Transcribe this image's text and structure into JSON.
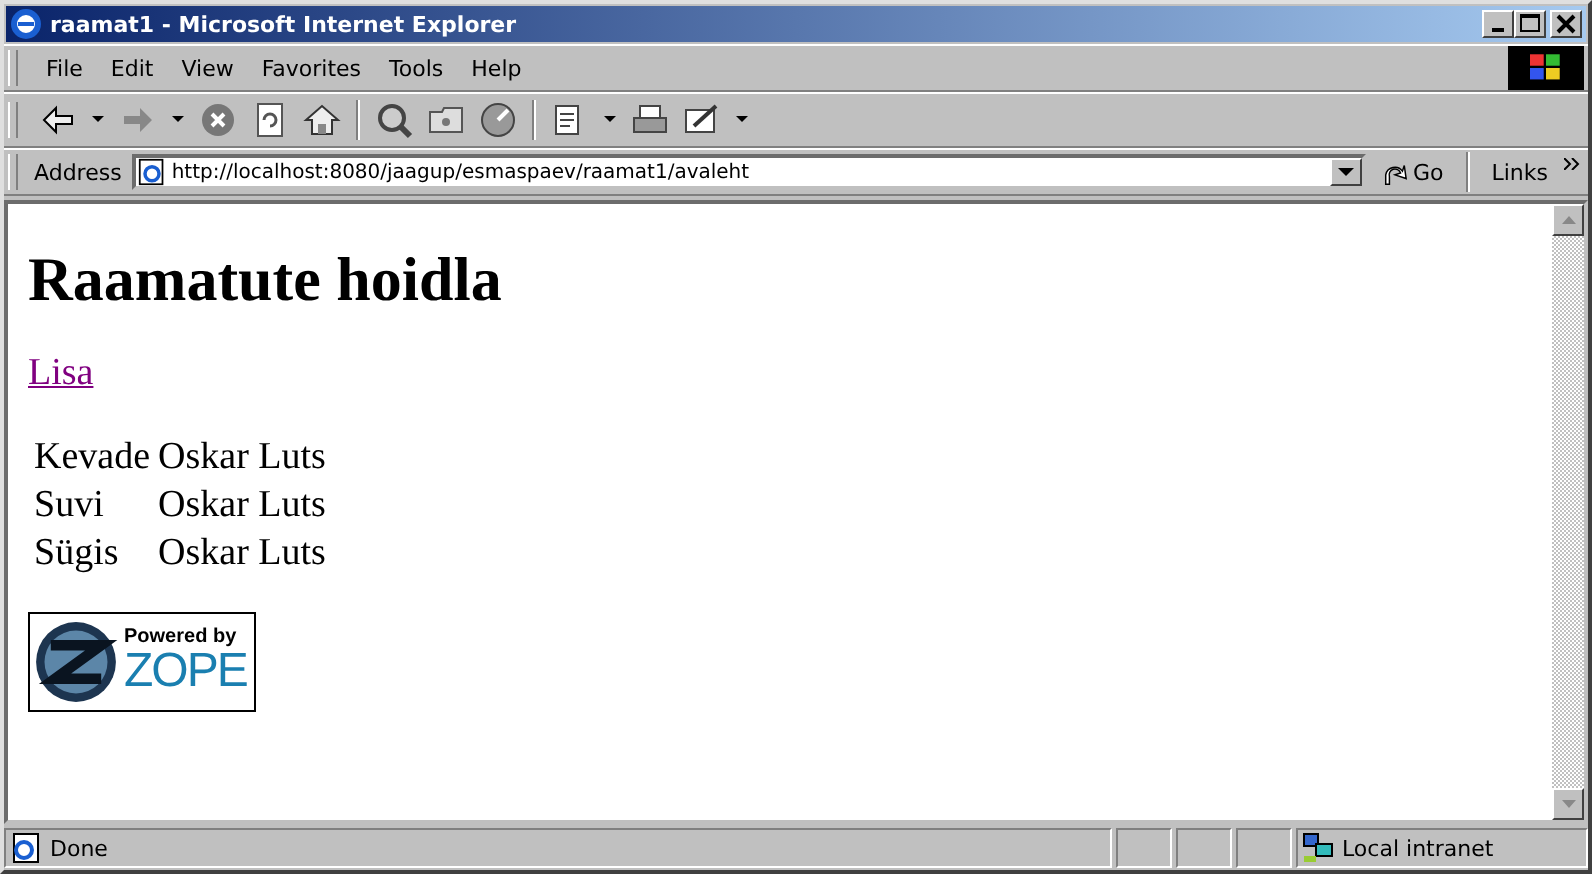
{
  "window": {
    "title": "raamat1 - Microsoft Internet Explorer"
  },
  "menu": {
    "items": [
      "File",
      "Edit",
      "View",
      "Favorites",
      "Tools",
      "Help"
    ]
  },
  "address_bar": {
    "label": "Address",
    "url": "http://localhost:8080/jaagup/esmaspaev/raamat1/avaleht",
    "go": "Go",
    "links": "Links"
  },
  "page": {
    "heading": "Raamatute hoidla",
    "link": {
      "text": "Lisa",
      "visited": true
    },
    "rows": [
      {
        "title": "Kevade",
        "author": "Oskar Luts"
      },
      {
        "title": "Suvi",
        "author": "Oskar Luts"
      },
      {
        "title": "Sügis",
        "author": "Oskar Luts"
      }
    ],
    "logo": {
      "line_1": "Powered by",
      "line_2": "ZOPE"
    }
  },
  "status_bar": {
    "text": "Done",
    "zone": "Local intranet"
  }
}
